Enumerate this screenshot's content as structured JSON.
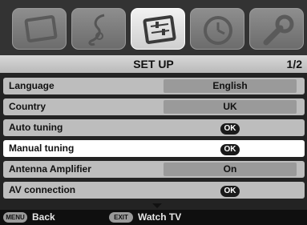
{
  "menu_tabs": [
    {
      "name": "picture",
      "icon": "picture-icon",
      "active": false
    },
    {
      "name": "sound",
      "icon": "music-note-icon",
      "active": false
    },
    {
      "name": "setup",
      "icon": "setup-sliders-icon",
      "active": true
    },
    {
      "name": "timer",
      "icon": "clock-icon",
      "active": false
    },
    {
      "name": "tools",
      "icon": "wrench-icon",
      "active": false
    }
  ],
  "header": {
    "title": "SET UP",
    "page": "1/2"
  },
  "menu": {
    "rows": [
      {
        "label": "Language",
        "value": "English",
        "type": "box"
      },
      {
        "label": "Country",
        "value": "UK",
        "type": "box"
      },
      {
        "label": "Auto tuning",
        "value": "OK",
        "type": "ok"
      },
      {
        "label": "Manual tuning",
        "value": "OK",
        "type": "ok"
      },
      {
        "label": "Antenna Amplifier",
        "value": "On",
        "type": "box"
      },
      {
        "label": "AV connection",
        "value": "OK",
        "type": "ok"
      }
    ],
    "selected_index": 3
  },
  "footer": {
    "menu_key": "MENU",
    "menu_action": "Back",
    "exit_key": "EXIT",
    "exit_action": "Watch TV"
  }
}
